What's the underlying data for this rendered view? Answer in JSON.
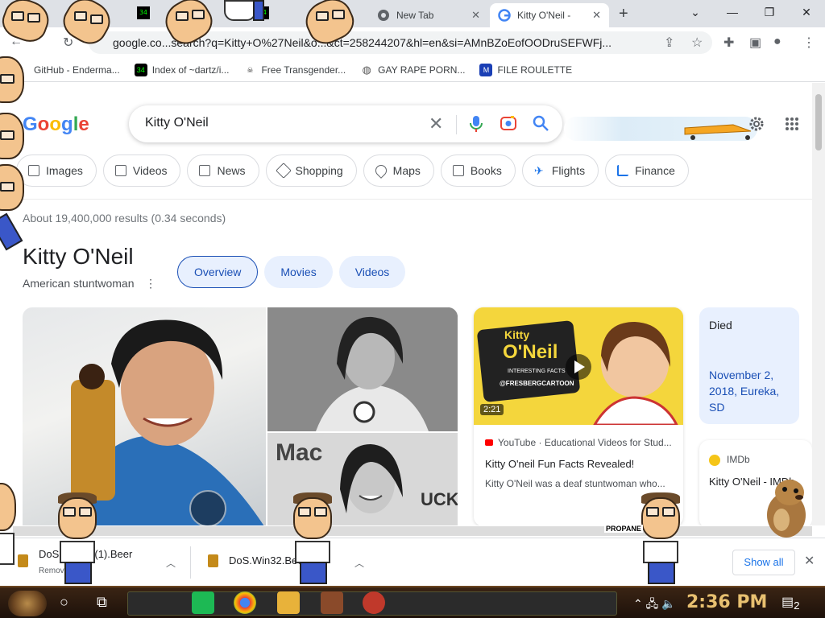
{
  "tabs": [
    {
      "label": "New Tab",
      "active": false
    },
    {
      "label": "Kitty O'Neil -",
      "active": true
    }
  ],
  "toolbar": {
    "url": "google.co...search?q=Kitty+O%27Neil&o...&ct=258244207&hl=en&si=AMnBZoEofOODruSEFWFj..."
  },
  "bookmarks": [
    {
      "label": "GitHub - Enderma...",
      "icon": "github-icon"
    },
    {
      "label": "Index of ~dartz/i...",
      "icon": "terminal-icon"
    },
    {
      "label": "Free Transgender...",
      "icon": "skull-icon"
    },
    {
      "label": "GAY RAPE PORN...",
      "icon": "globe-icon"
    },
    {
      "label": "FILE ROULETTE",
      "icon": "ml-icon"
    }
  ],
  "search": {
    "query": "Kitty O'Neil"
  },
  "chips": [
    {
      "label": "Images",
      "icon": "image-icon"
    },
    {
      "label": "Videos",
      "icon": "video-icon"
    },
    {
      "label": "News",
      "icon": "news-icon"
    },
    {
      "label": "Shopping",
      "icon": "tag-icon"
    },
    {
      "label": "Maps",
      "icon": "pin-icon"
    },
    {
      "label": "Books",
      "icon": "book-icon"
    },
    {
      "label": "Flights",
      "icon": "plane-icon"
    },
    {
      "label": "Finance",
      "icon": "chart-icon"
    }
  ],
  "results_stats": "About 19,400,000 results (0.34 seconds)",
  "knowledge_panel": {
    "title": "Kitty O'Neil",
    "subtitle": "American stuntwoman",
    "tabs": [
      {
        "label": "Overview",
        "selected": true
      },
      {
        "label": "Movies",
        "selected": false
      },
      {
        "label": "Videos",
        "selected": false
      }
    ]
  },
  "video_card": {
    "thumb_title_line1": "Kitty",
    "thumb_title_line2": "O'Neil",
    "thumb_caption": "INTERESTING FACTS",
    "thumb_handle": "@FRESBERGCARTOON",
    "duration": "2:21",
    "source": "YouTube · Educational Videos for Stud...",
    "title": "Kitty O'neil Fun Facts Revealed!",
    "description": "Kitty O'Neil was a deaf stuntwoman who..."
  },
  "died_card": {
    "label": "Died",
    "value": "November 2, 2018, Eureka, SD"
  },
  "imdb_card": {
    "source": "IMDb",
    "title": "Kitty O'Neil - IMDb"
  },
  "downloads": [
    {
      "name": "DoS.W...32 (1).Beer",
      "meta": "Remove..."
    },
    {
      "name": "DoS.Win32.Bee..."
    }
  ],
  "download_bar": {
    "show_all": "Show all"
  },
  "overlay": {
    "propane_label": "PROPANE"
  },
  "taskbar": {
    "time": "2:36 PM",
    "notification_count": "2"
  },
  "colors": {
    "google_blue": "#4285f4",
    "link_blue": "#1a4fb5",
    "chip_border": "#dadce0",
    "kp_tab_bg": "#e8f0fe",
    "taskbar_bg": "#3a2414",
    "clock": "#e8c070"
  }
}
